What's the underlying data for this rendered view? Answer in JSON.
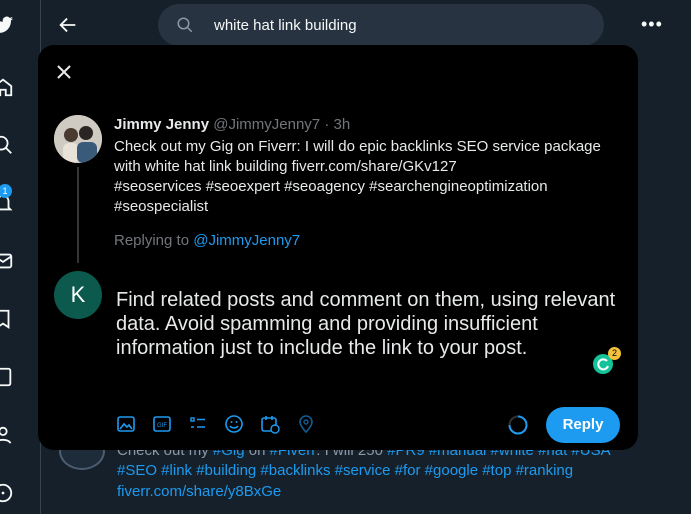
{
  "header": {
    "search_query": "white hat link building",
    "back_icon": "arrow-left-icon",
    "more_icon": "more-horizontal-icon"
  },
  "nav": {
    "icons": [
      "twitter-logo-icon",
      "home-icon",
      "explore-icon",
      "notifications-icon",
      "messages-icon",
      "bookmarks-icon",
      "lists-icon",
      "profile-icon",
      "more-circle-icon"
    ],
    "notification_count": "1"
  },
  "modal": {
    "close_icon": "close-icon",
    "original_tweet": {
      "author_name": "Jimmy Jenny",
      "author_handle": "@JimmyJenny7",
      "separator": "·",
      "time": "3h",
      "body_lines": [
        "Check out my Gig on Fiverr: I will do epic backlinks SEO service package",
        "with white hat link building fiverr.com/share/GKv127",
        "#seoservices #seoexpert #seoagency #searchengineoptimization",
        "#seospecialist"
      ]
    },
    "replying_label": "Replying to",
    "replying_handle": "@JimmyJenny7",
    "user_initial": "K",
    "compose_text": "Find related posts and comment on them, using relevant data. Avoid spamming and providing insufficient information just to include the link to your post.",
    "grammarly_count": "2",
    "toolbar_icons": [
      "media-icon",
      "gif-icon",
      "poll-icon",
      "emoji-icon",
      "schedule-icon",
      "location-icon"
    ],
    "reply_button": "Reply"
  },
  "background_tweet": {
    "line1_prefix": "Check out my",
    "line1_tag1": "#Gig",
    "line1_mid": "on",
    "line1_tag2": "#Fiverr",
    "line1_rest": ": I will 250",
    "line1_tags": "#PR9 #manual #white #hat #USA",
    "line2": "#SEO #link #building #backlinks #service #for #google #top #ranking",
    "line3": "fiverr.com/share/y8BxGe"
  },
  "colors": {
    "accent": "#1d9bf0",
    "modal_bg": "#000000",
    "page_bg": "#15202b",
    "avatar_k": "#0b5a4d"
  }
}
